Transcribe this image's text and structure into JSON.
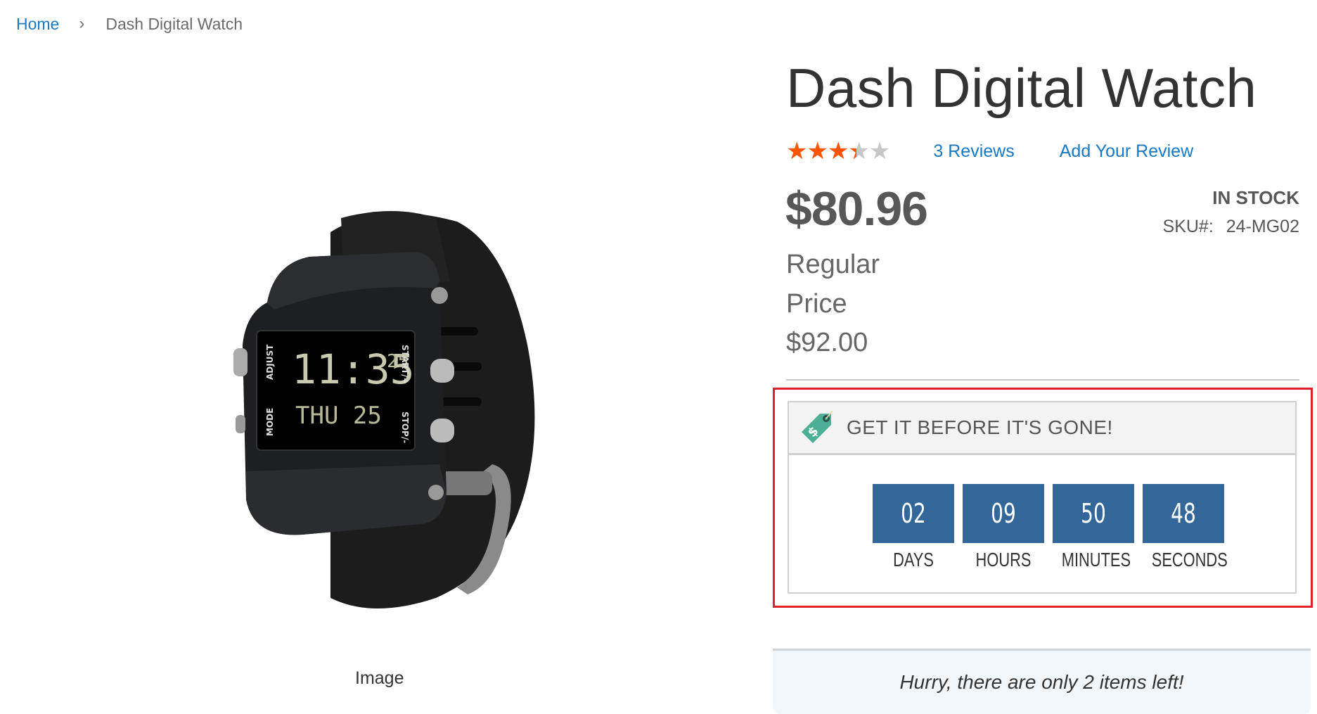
{
  "breadcrumb": {
    "home": "Home",
    "separator": "›",
    "current": "Dash Digital Watch"
  },
  "media": {
    "caption": "Image",
    "watch_display": {
      "time": "11:35",
      "seconds": "25",
      "day": "THU 25"
    },
    "watch_buttons": {
      "adjust": "ADJUST",
      "mode": "MODE",
      "start": "START/+",
      "stop": "STOP/-"
    }
  },
  "product": {
    "title": "Dash Digital Watch",
    "rating": {
      "percent": 68,
      "max_stars": 5,
      "stars_glyph": "★★★★★"
    },
    "reviews_link": "3  Reviews",
    "add_review_link": "Add Your Review",
    "price": "$80.96",
    "old_price_label": "Regular Price",
    "old_price": "$92.00",
    "stock_status": "IN STOCK",
    "sku_label": "SKU#:",
    "sku_value": "24-MG02"
  },
  "countdown": {
    "header": "GET IT BEFORE IT'S GONE!",
    "icon": "price-tag-icon",
    "units": [
      {
        "value": "02",
        "label": "DAYS"
      },
      {
        "value": "09",
        "label": "HOURS"
      },
      {
        "value": "50",
        "label": "MINUTES"
      },
      {
        "value": "48",
        "label": "SECONDS"
      }
    ],
    "colors": {
      "box": "#336699",
      "highlight_border": "#e22128"
    }
  },
  "stock_notice": "Hurry, there are only 2 items left!",
  "colors": {
    "link": "#1979c3",
    "star_on": "#ff5501",
    "star_off": "#c7c7c7"
  }
}
